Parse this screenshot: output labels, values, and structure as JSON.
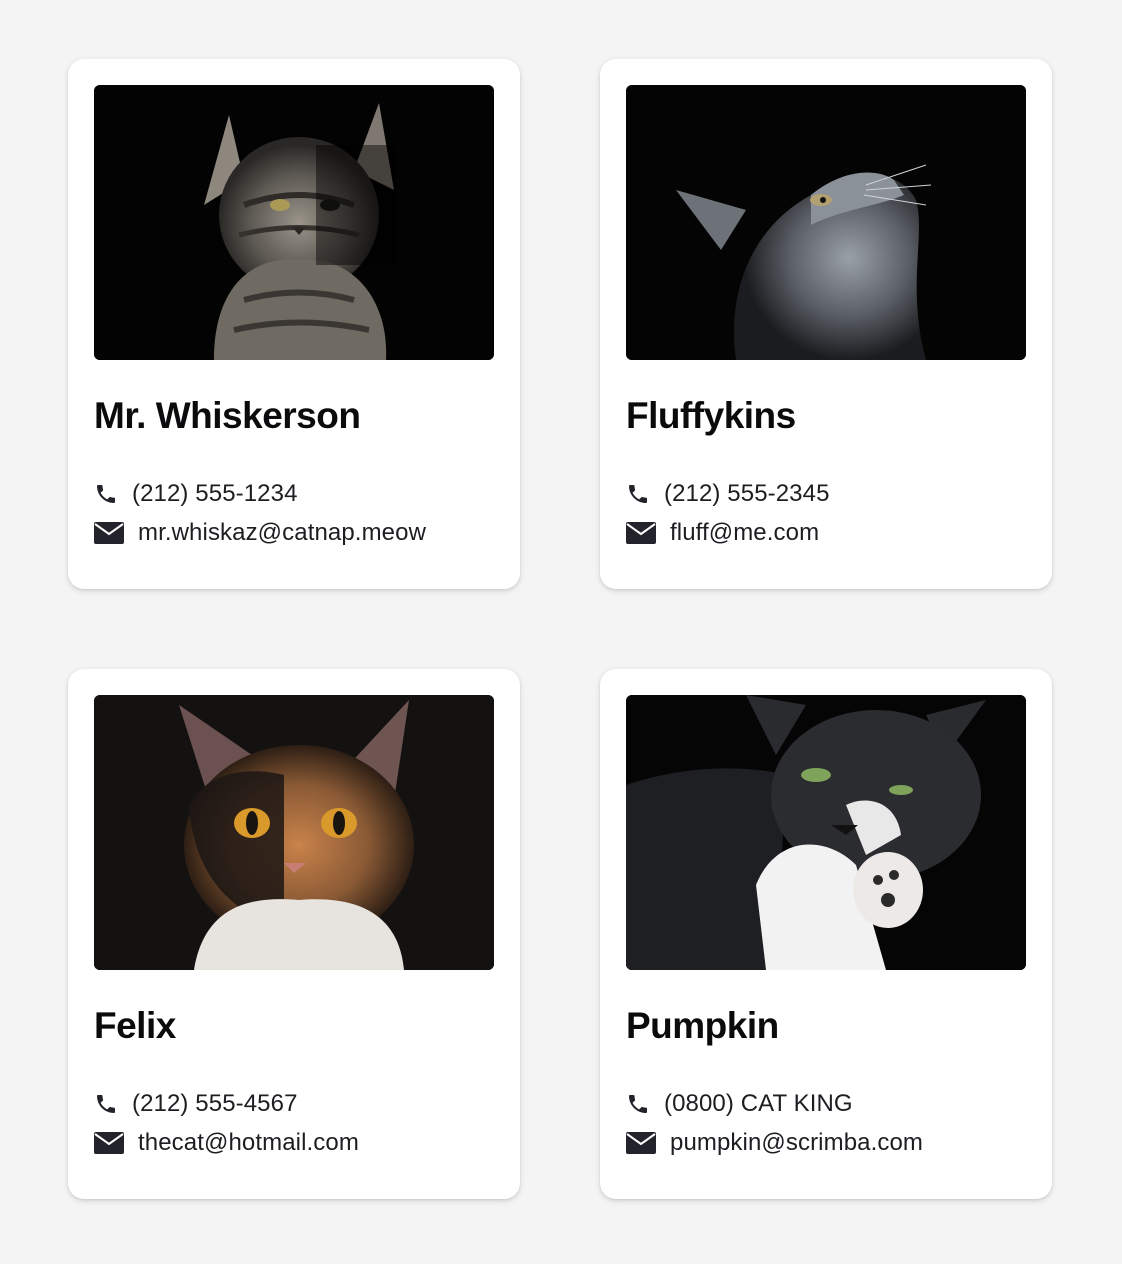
{
  "colors": {
    "page_background": "#f4f4f4",
    "card_background": "#ffffff",
    "text": "#0b0b0d",
    "icon": "#23232b"
  },
  "icons": {
    "phone": "phone-icon",
    "email": "envelope-icon"
  },
  "contacts": [
    {
      "name": "Mr. Whiskerson",
      "phone": "(212) 555-1234",
      "email": "mr.whiskaz@catnap.meow",
      "photo": "tabby-cat-photo"
    },
    {
      "name": "Fluffykins",
      "phone": "(212) 555-2345",
      "email": "fluff@me.com",
      "photo": "grey-fluffy-cat-photo"
    },
    {
      "name": "Felix",
      "phone": "(212) 555-4567",
      "email": "thecat@hotmail.com",
      "photo": "calico-cat-photo"
    },
    {
      "name": "Pumpkin",
      "phone": "(0800) CAT KING",
      "email": "pumpkin@scrimba.com",
      "photo": "tuxedo-cat-photo"
    }
  ]
}
